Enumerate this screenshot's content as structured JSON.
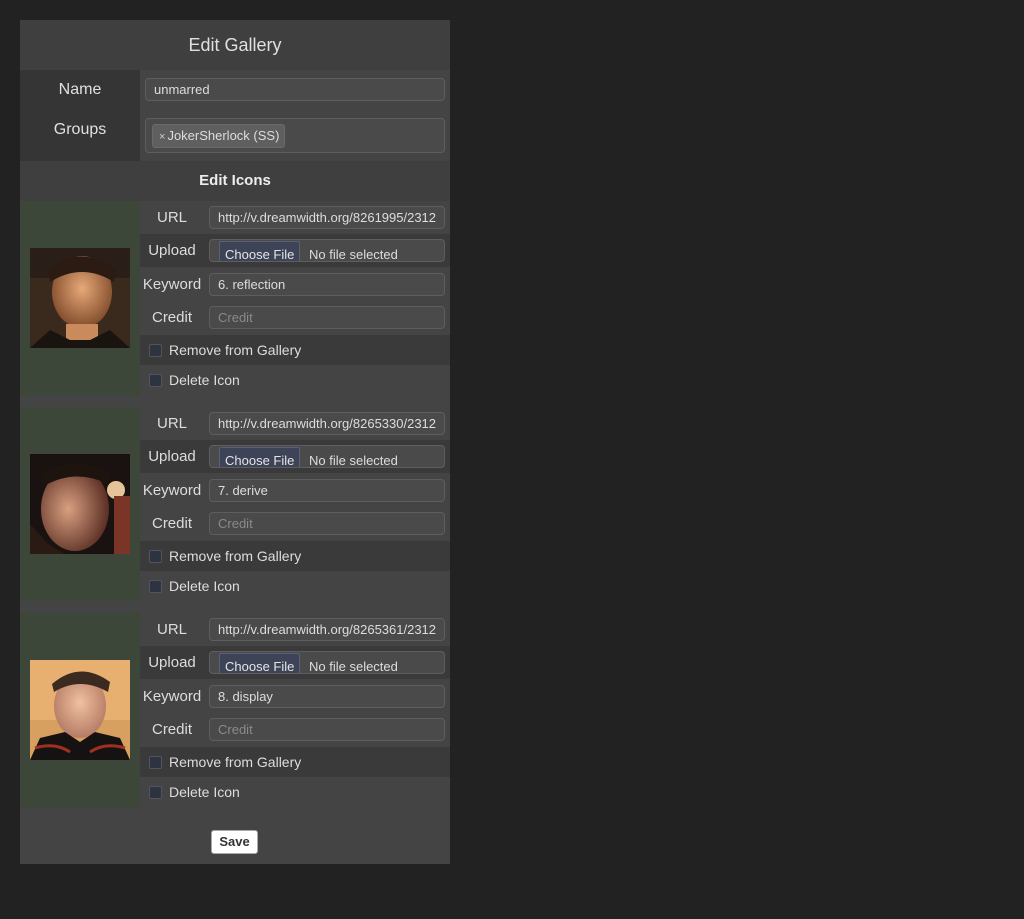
{
  "title": "Edit Gallery",
  "name": {
    "label": "Name",
    "value": "unmarred"
  },
  "groups": {
    "label": "Groups",
    "tags": [
      {
        "remove": "×",
        "label": "JokerSherlock (SS)"
      }
    ]
  },
  "section_title": "Edit Icons",
  "field_labels": {
    "url": "URL",
    "upload": "Upload",
    "keyword": "Keyword",
    "credit": "Credit"
  },
  "file_input": {
    "button": "Choose File",
    "status": "No file selected"
  },
  "credit_placeholder": "Credit",
  "checkbox_labels": {
    "remove": "Remove from Gallery",
    "delete": "Delete Icon"
  },
  "icons": [
    {
      "url": "http://v.dreamwidth.org/8261995/2312",
      "keyword": "6. reflection",
      "credit": ""
    },
    {
      "url": "http://v.dreamwidth.org/8265330/2312",
      "keyword": "7. derive",
      "credit": ""
    },
    {
      "url": "http://v.dreamwidth.org/8265361/2312",
      "keyword": "8. display",
      "credit": ""
    }
  ],
  "save_label": "Save",
  "colors": {
    "page_bg": "#222222",
    "panel_bg": "#444444",
    "thumb_col_bg": "#3c473a",
    "file_button_bg": "#3d4458"
  }
}
